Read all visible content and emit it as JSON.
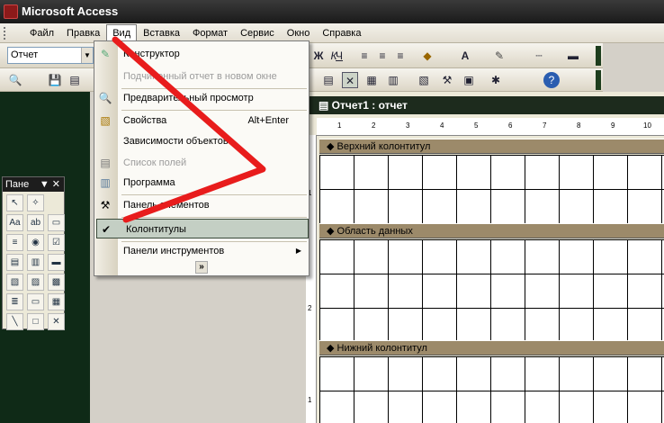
{
  "app_title": "Microsoft Access",
  "menubar": [
    "Файл",
    "Правка",
    "Вид",
    "Вставка",
    "Формат",
    "Сервис",
    "Окно",
    "Справка"
  ],
  "toolbar": {
    "object_combo_value": "Отчет",
    "format_buttons": [
      "Ж",
      "К",
      "Ч"
    ]
  },
  "report_title": "Отчет1 : отчет",
  "sections": [
    "Верхний колонтитул",
    "Область данных",
    "Нижний колонтитул"
  ],
  "ruler_numbers": [
    "1",
    "2",
    "3",
    "4",
    "5",
    "6",
    "7",
    "8",
    "9",
    "10"
  ],
  "vruler_numbers": [
    "1",
    "2",
    "1"
  ],
  "toolbox": {
    "title": "Пане"
  },
  "view_menu": {
    "items": [
      {
        "label": "Конструктор",
        "icon": "design-view-icon",
        "enabled": true
      },
      {
        "label": "Подчиненный отчет в новом окне",
        "enabled": false
      },
      {
        "label": "Предварительный просмотр",
        "icon": "preview-icon",
        "enabled": true
      },
      {
        "label": "Свойства",
        "shortcut": "Alt+Enter",
        "icon": "properties-icon",
        "enabled": true
      },
      {
        "label": "Зависимости объектов...",
        "enabled": true
      },
      {
        "label": "Список полей",
        "icon": "field-list-icon",
        "enabled": false
      },
      {
        "label": "Программа",
        "icon": "code-icon",
        "enabled": true
      },
      {
        "label": "Панель элементов",
        "icon": "toolbox-icon",
        "enabled": true
      },
      {
        "label": "Колонтитулы",
        "icon": "checkmark-icon",
        "enabled": true,
        "checked": true,
        "highlighted": true
      },
      {
        "label": "Панели инструментов",
        "enabled": true,
        "submenu": true
      }
    ],
    "expand_glyph": "»"
  },
  "accent_color": "#e81c1c"
}
